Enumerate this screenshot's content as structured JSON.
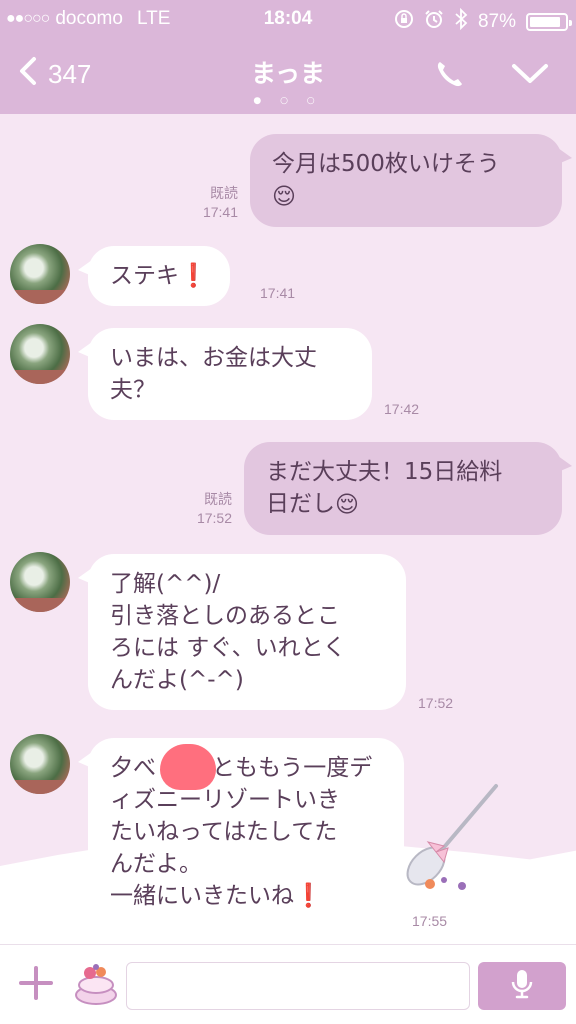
{
  "status_bar": {
    "signal_dots": "●●○○○",
    "carrier": "docomo",
    "network": "LTE",
    "time": "18:04",
    "battery": "87%",
    "battery_level": 0.87
  },
  "header": {
    "back_count": "347",
    "title": "まっま",
    "page_dots": "● ○ ○"
  },
  "messages": [
    {
      "dir": "out",
      "text": "今月は500枚いけそう",
      "emoji": "😌",
      "read": "既読",
      "time": "17:41"
    },
    {
      "dir": "in",
      "text": "ステキ",
      "emoji": "❗",
      "time": "17:41"
    },
    {
      "dir": "in",
      "line1": "いまは、お金は大丈",
      "line2": "夫？",
      "time": "17:42"
    },
    {
      "dir": "out",
      "line1": "まだ大丈夫！15日給料",
      "line2": "日だし",
      "emoji": "😌",
      "read": "既読",
      "time": "17:52"
    },
    {
      "dir": "in",
      "line1": "了解(^^)/",
      "line2": "引き落としのあるとこ",
      "line3": "ろには すぐ、いれとく",
      "line4": "んだよ(^-^)",
      "time": "17:52"
    },
    {
      "dir": "in",
      "line1": "夕べ",
      "line1b": "とももう一度デ",
      "line2": "ィズニーリゾートいき",
      "line3": "たいねってはたしてた",
      "line4": "んだよ。",
      "line5": "一緒にいきたいね",
      "emoji": "❗",
      "time": "17:55"
    }
  ],
  "input": {
    "placeholder": ""
  },
  "colors": {
    "header": "#dbb7d9",
    "chat_bg": "#f6e6f3",
    "bubble_out": "#e2c6df",
    "bubble_in": "#ffffff",
    "text": "#5a3f5a",
    "mic_button": "#d2a1cd"
  },
  "icons": [
    "back-chevron-icon",
    "phone-icon",
    "chevron-down-icon",
    "plus-icon",
    "sticker-icon",
    "mic-icon",
    "lock-rotation-icon",
    "alarm-icon",
    "bluetooth-icon",
    "battery-icon"
  ]
}
